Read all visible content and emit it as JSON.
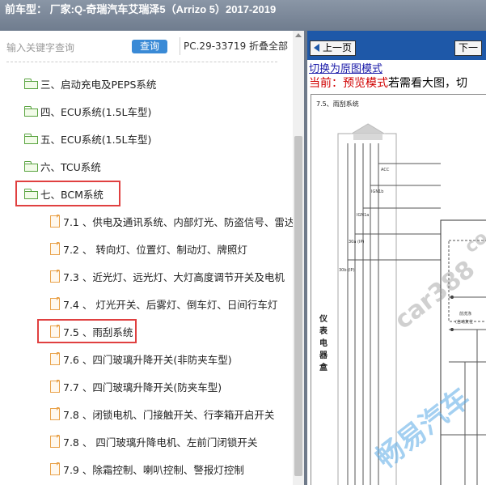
{
  "titlebar": {
    "text": "前车型： 厂家:Q-奇瑞汽车艾瑞泽5（Arrizo 5）2017-2019"
  },
  "search": {
    "placeholder": "输入关键字查询",
    "button_label": "查询",
    "pc_number": "PC.29-33719",
    "collapse_label": "折叠全部"
  },
  "tree": {
    "folders": [
      {
        "label": "三、启动充电及PEPS系统"
      },
      {
        "label": "四、ECU系统(1.5L车型)"
      },
      {
        "label": "五、ECU系统(1.5L车型)"
      },
      {
        "label": "六、TCU系统"
      },
      {
        "label": "七、BCM系统"
      }
    ],
    "files": [
      {
        "label": "7.1 、供电及通讯系统、内部灯光、防盗信号、雷达"
      },
      {
        "label": "7.2 、 转向灯、位置灯、制动灯、牌照灯"
      },
      {
        "label": "7.3 、近光灯、远光灯、大灯高度调节开关及电机"
      },
      {
        "label": "7.4 、 灯光开关、后雾灯、倒车灯、日间行车灯"
      },
      {
        "label": "7.5 、雨刮系统"
      },
      {
        "label": "7.6 、四门玻璃升降开关(非防夹车型)"
      },
      {
        "label": "7.7 、四门玻璃升降开关(防夹车型)"
      },
      {
        "label": "7.8 、闭锁电机、门接触开关、行李箱开启开关"
      },
      {
        "label": "7.8 、 四门玻璃升降电机、左前门闭锁开关"
      },
      {
        "label": "7.9 、除霜控制、喇叭控制、警报灯控制"
      }
    ]
  },
  "viewer": {
    "prev_label": "上一页",
    "next_label": "下一",
    "switch_link": "切换为原图模式",
    "current_prefix": "当前：",
    "current_mode": "预览模式",
    "current_suffix": "若需看大图，切",
    "diagram": {
      "title": "7.5、雨刮系统",
      "labels": {
        "acc": "ACC",
        "ign1b": "IGN1b",
        "ign1a": "IGN1a",
        "f30a": "30a (IP)",
        "f30b": "30b (IP)",
        "box": "仪表电器盒",
        "front_wash": "前洗涤",
        "auto_reset": "(自动复位"
      }
    },
    "watermarks": {
      "w1": "car388",
      "w2": "畅易汽车",
      "w3": "co"
    }
  },
  "colors": {
    "titlebar": "#6f7c8e",
    "query_button": "#3a8ad6",
    "folder_green": "#58a33e",
    "file_orange": "#e9a24a",
    "highlight_red": "#e04040",
    "nav_blue": "#1e58a8",
    "red_text": "#d00000"
  }
}
